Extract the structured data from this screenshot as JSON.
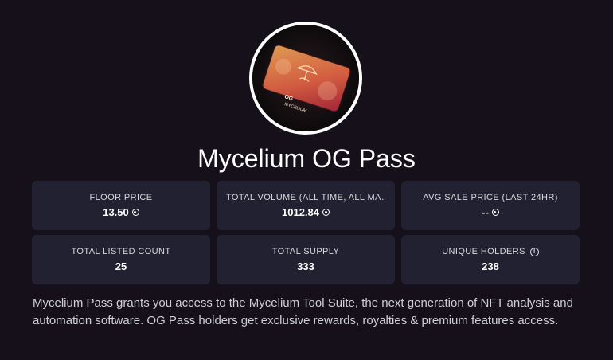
{
  "collection": {
    "name": "Mycelium OG Pass",
    "image_icon": "og-pass-card-image",
    "card_image_text": [
      "OG",
      "MYCELIUM"
    ]
  },
  "stats": [
    {
      "label": "FLOOR PRICE",
      "value": "13.50",
      "currency_icon": "sol-icon"
    },
    {
      "label": "TOTAL VOLUME (ALL TIME, ALL MA…",
      "value": "1012.84",
      "currency_icon": "sol-icon"
    },
    {
      "label": "AVG SALE PRICE (LAST 24HR)",
      "value": "--",
      "currency_icon": "sol-icon"
    },
    {
      "label": "TOTAL LISTED COUNT",
      "value": "25"
    },
    {
      "label": "TOTAL SUPPLY",
      "value": "333"
    },
    {
      "label": "UNIQUE HOLDERS",
      "value": "238",
      "info_icon": "info-icon",
      "info_glyph": "i"
    }
  ],
  "description": "Mycelium Pass grants you access to the Mycelium Tool Suite, the next generation of NFT analysis and automation software. OG Pass holders get exclusive rewards, royalties & premium features access.",
  "colors": {
    "background": "#15101a",
    "card": "#222131",
    "card_gradient_start": "#ff9a4a",
    "card_gradient_end": "#e0415a"
  }
}
